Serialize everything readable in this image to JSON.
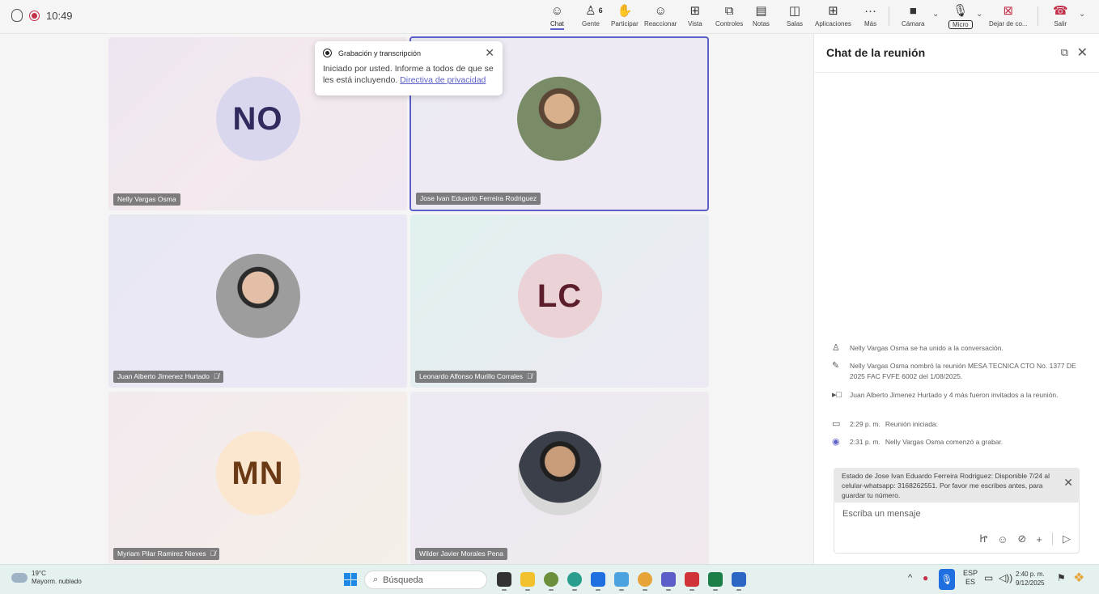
{
  "topbar": {
    "time": "10:49",
    "buttons": {
      "chat": "Chat",
      "people": "Gente",
      "people_count": "6",
      "raise": "Participar",
      "react": "Reaccionar",
      "view": "Vista",
      "controls": "Controles",
      "notes": "Notas",
      "rooms": "Salas",
      "apps": "Aplicaciones",
      "more": "Más",
      "camera": "Cámara",
      "mic": "Micro",
      "stop_share": "Dejar de co...",
      "leave": "Salir"
    }
  },
  "participants": [
    {
      "name": "Nelly Vargas Osma",
      "initials": "NO",
      "muted": false
    },
    {
      "name": "Jose Ivan Eduardo Ferreira Rodriguez",
      "initials": "",
      "muted": false
    },
    {
      "name": "Juan Alberto Jimenez Hurtado",
      "initials": "",
      "muted": true
    },
    {
      "name": "Leonardo Alfonso Murillo Corrales",
      "initials": "LC",
      "muted": true
    },
    {
      "name": "Myriam Pilar Ramirez Nieves",
      "initials": "MN",
      "muted": true
    },
    {
      "name": "Wilder Javier Morales Pena",
      "initials": "",
      "muted": false
    }
  ],
  "toast": {
    "title": "Grabación y transcripción",
    "body": "Iniciado por usted. Informe a todos de que se les está incluyendo.",
    "link": "Directiva de privacidad"
  },
  "chat": {
    "title": "Chat de la reunión",
    "events": [
      {
        "text": "Nelly Vargas Osma se ha unido a la conversación."
      },
      {
        "text": "Nelly Vargas Osma nombró la reunión MESA TECNICA CTO No. 1377 DE 2025 FAC FVFE 6002 del 1/08/2025."
      },
      {
        "text": "Juan Alberto Jimenez Hurtado y 4 más fueron invitados a la reunión."
      },
      {
        "time": "2:29 p. m.",
        "text": "Reunión iniciada:"
      },
      {
        "time": "2:31 p. m.",
        "text": "Nelly Vargas Osma comenzó a grabar."
      }
    ],
    "status_card": "Estado de Jose Ivan Eduardo Ferreira Rodriguez: Disponible 7/24 al celular-whatsapp: 3168262551. Por favor me escribes antes, para guardar tu número.",
    "compose_placeholder": "Escriba un mensaje"
  },
  "taskbar": {
    "weather_temp": "19°C",
    "weather_desc": "Mayorm. nublado",
    "search": "Búsqueda",
    "lang_top": "ESP",
    "lang_bottom": "ES",
    "clock_time": "2:40 p. m.",
    "clock_date": "9/12/2025"
  }
}
